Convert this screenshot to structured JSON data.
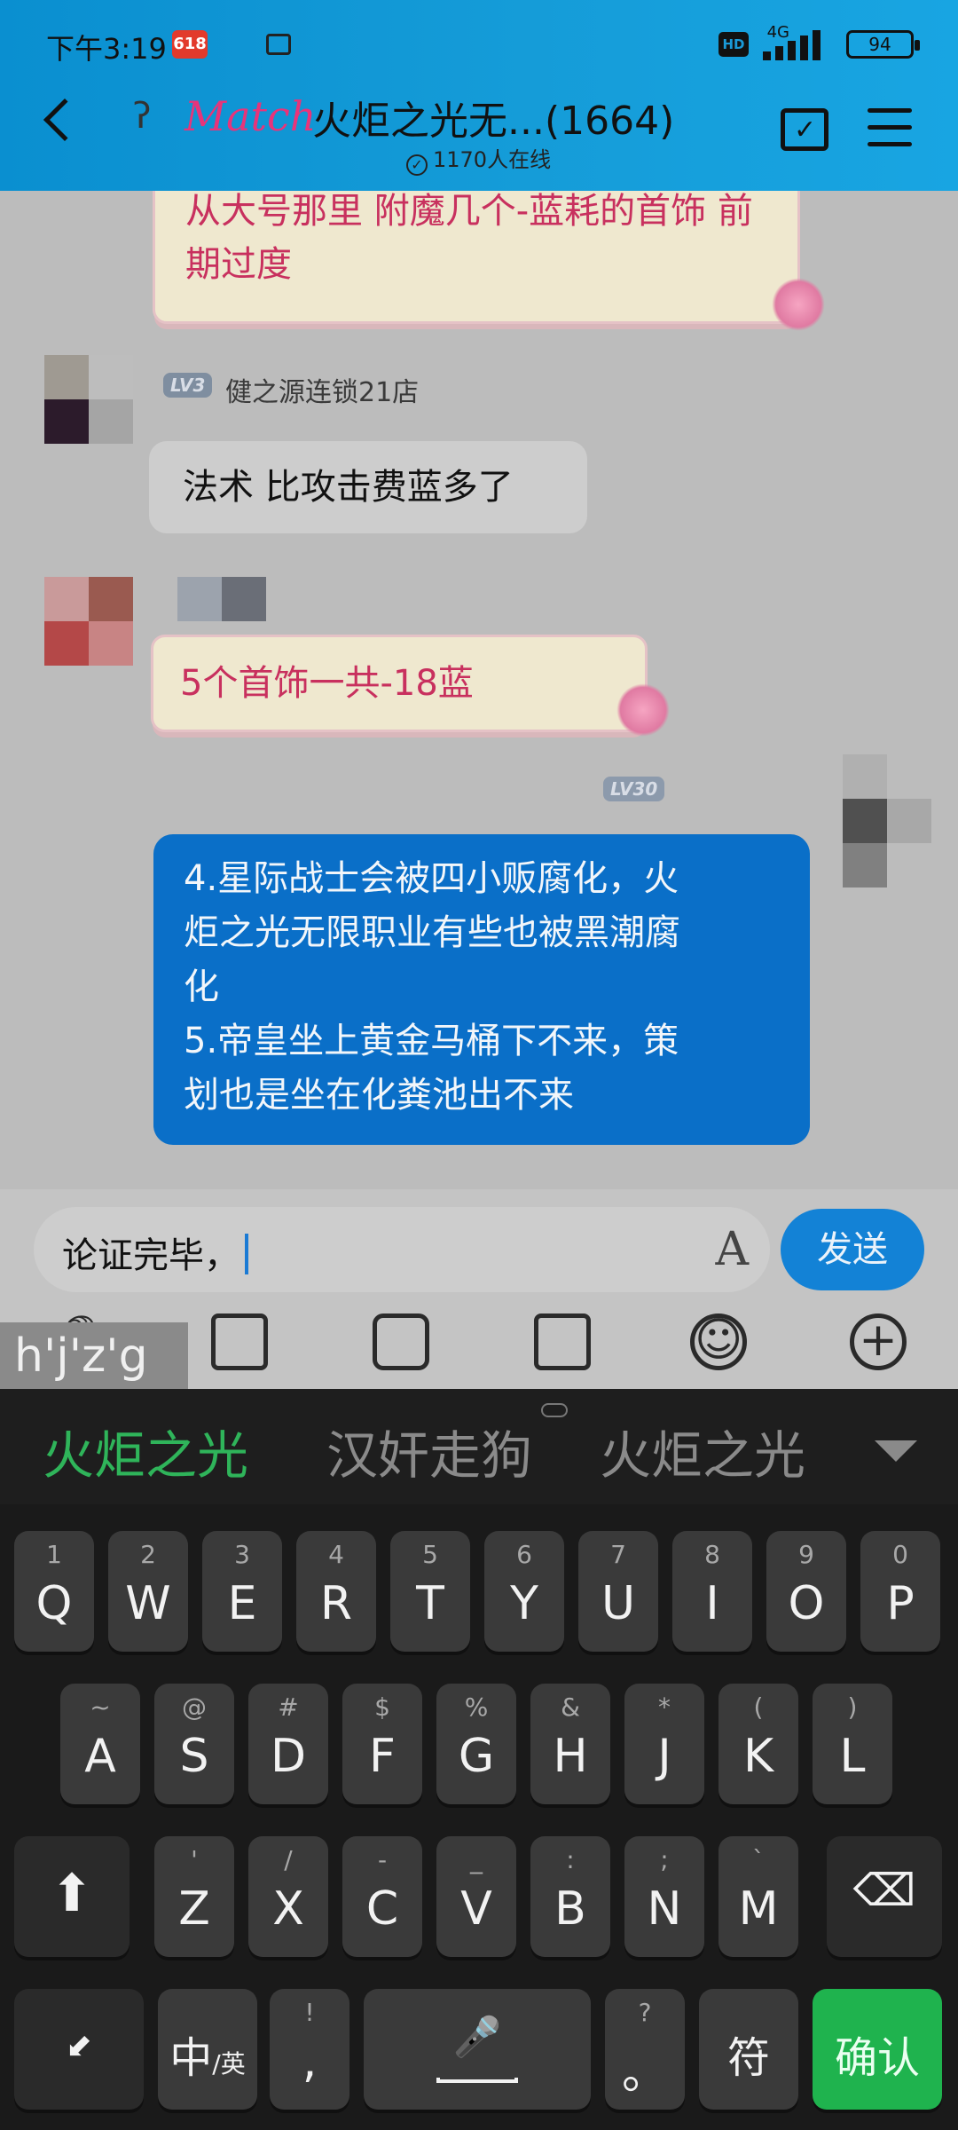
{
  "status": {
    "time": "下午3:19",
    "badge": "618",
    "hd": "HD",
    "network": "4G",
    "battery": "94"
  },
  "header": {
    "logo": "Match",
    "title": "火炬之光无...(1664)",
    "online": "1170人在线"
  },
  "messages": {
    "m1_text": "从大号那里 附魔几个-蓝耗的首饰 前期过度",
    "m2_level": "LV3",
    "m2_user": "健之源连锁21店",
    "m2_text": "法术 比攻击费蓝多了",
    "m3_text": "5个首饰一共-18蓝",
    "m4_level": "LV30",
    "m4_line1": "4.星际战士会被四小贩腐化，火",
    "m4_line2": "炬之光无限职业有些也被黑潮腐",
    "m4_line3": "化",
    "m4_line4": "5.帝皇坐上黄金马桶下不来，策",
    "m4_line5": "划也是坐在化粪池出不来"
  },
  "input": {
    "value": "论证完毕，",
    "send_label": "发送"
  },
  "pinyin": "h'j'z'g",
  "candidates": [
    "火炬之光",
    "汉奸走狗",
    "火炬之光"
  ],
  "keyboard": {
    "row1": [
      {
        "hint": "1",
        "key": "Q"
      },
      {
        "hint": "2",
        "key": "W"
      },
      {
        "hint": "3",
        "key": "E"
      },
      {
        "hint": "4",
        "key": "R"
      },
      {
        "hint": "5",
        "key": "T"
      },
      {
        "hint": "6",
        "key": "Y"
      },
      {
        "hint": "7",
        "key": "U"
      },
      {
        "hint": "8",
        "key": "I"
      },
      {
        "hint": "9",
        "key": "O"
      },
      {
        "hint": "0",
        "key": "P"
      }
    ],
    "row2": [
      {
        "hint": "~",
        "key": "A"
      },
      {
        "hint": "@",
        "key": "S"
      },
      {
        "hint": "#",
        "key": "D"
      },
      {
        "hint": "$",
        "key": "F"
      },
      {
        "hint": "%",
        "key": "G"
      },
      {
        "hint": "&",
        "key": "H"
      },
      {
        "hint": "*",
        "key": "J"
      },
      {
        "hint": "(",
        "key": "K"
      },
      {
        "hint": ")",
        "key": "L"
      }
    ],
    "row3": [
      {
        "hint": "'",
        "key": "Z"
      },
      {
        "hint": "/",
        "key": "X"
      },
      {
        "hint": "-",
        "key": "C"
      },
      {
        "hint": "_",
        "key": "V"
      },
      {
        "hint": ":",
        "key": "B"
      },
      {
        "hint": ";",
        "key": "N"
      },
      {
        "hint": "`",
        "key": "M"
      }
    ],
    "lang_main": "中",
    "lang_sub": "/英",
    "punct_hint": "!",
    "punct_key": ",",
    "period_hint": "?",
    "period_key": "。",
    "symbol_key": "符",
    "confirm_key": "确认"
  }
}
